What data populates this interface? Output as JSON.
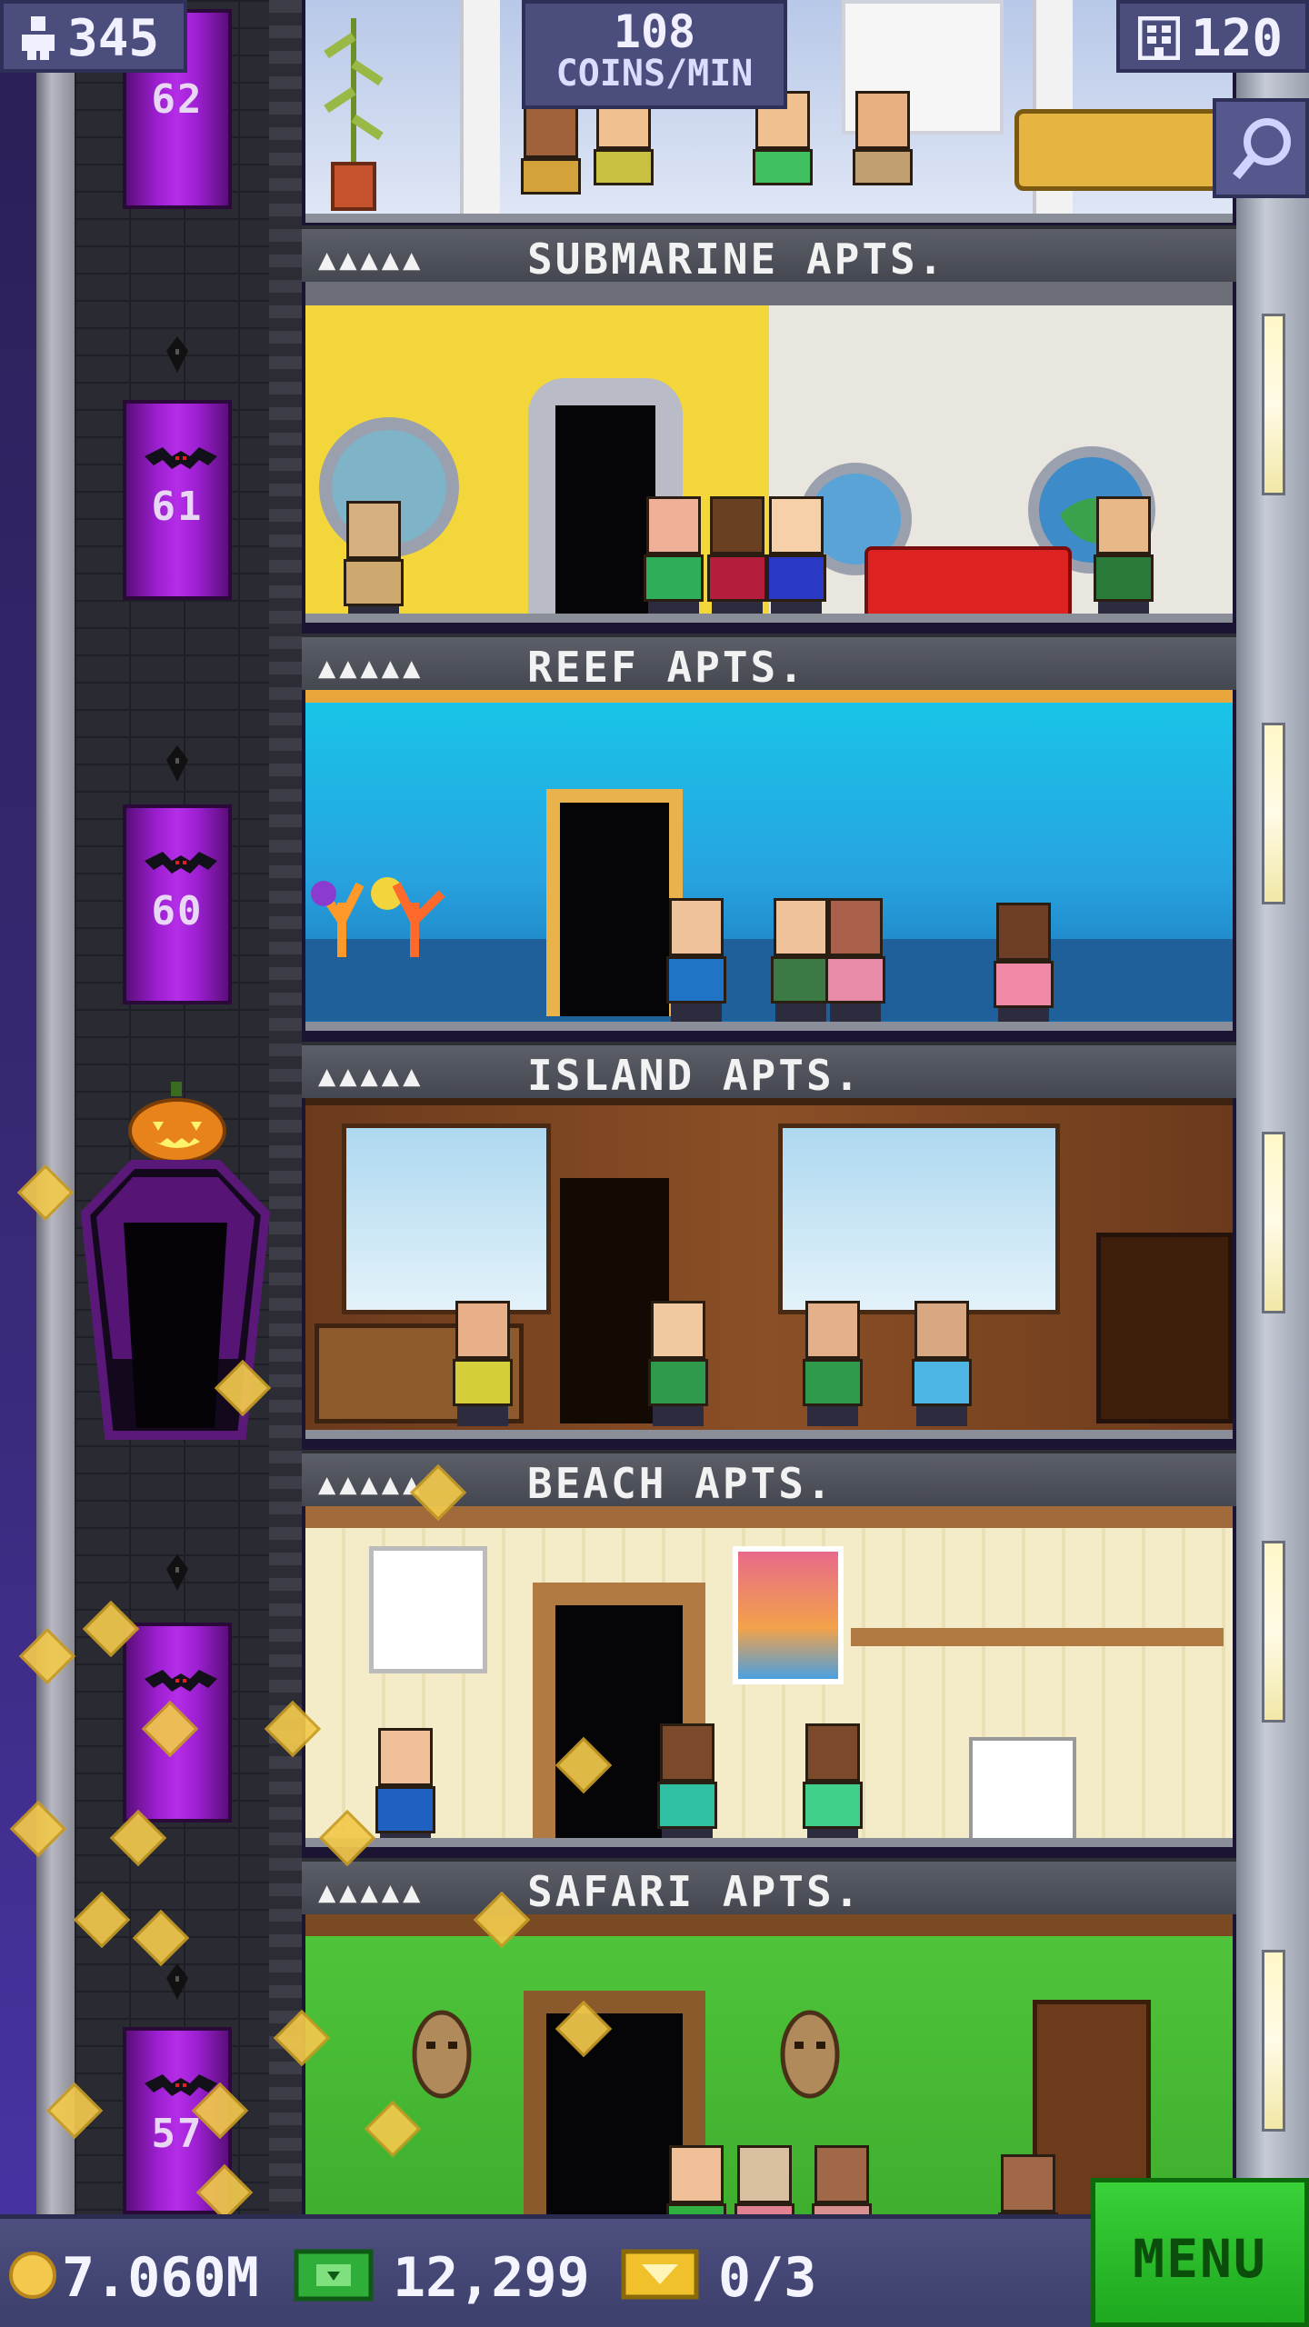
{
  "hud": {
    "population": "345",
    "coins_per_min_value": "108",
    "coins_per_min_unit": "COINS/MIN",
    "floors": "120"
  },
  "elevator": {
    "floor_numbers": [
      "62",
      "61",
      "60",
      "57"
    ]
  },
  "floors": [
    {
      "name": "SUBMARINE APTS.",
      "stars": "▲▲▲▲▲"
    },
    {
      "name": "REEF APTS.",
      "stars": "▲▲▲▲▲"
    },
    {
      "name": "ISLAND APTS.",
      "stars": "▲▲▲▲▲"
    },
    {
      "name": "BEACH APTS.",
      "stars": "▲▲▲▲▲"
    },
    {
      "name": "SAFARI APTS.",
      "stars": "▲▲▲▲▲"
    }
  ],
  "bottom_bar": {
    "coins": "7.060M",
    "bux": "12,299",
    "tickets": "0/3",
    "menu_label": "MENU"
  },
  "colors": {
    "hud_bg": "#4b4d7d",
    "menu_green": "#2bbd2b",
    "elevator_purple": "#9c1fd0",
    "coin_gold": "#f2c94c"
  },
  "icons": [
    "person-icon",
    "floors-icon",
    "magnifier-icon",
    "coin-icon",
    "bux-icon",
    "ticket-icon"
  ]
}
